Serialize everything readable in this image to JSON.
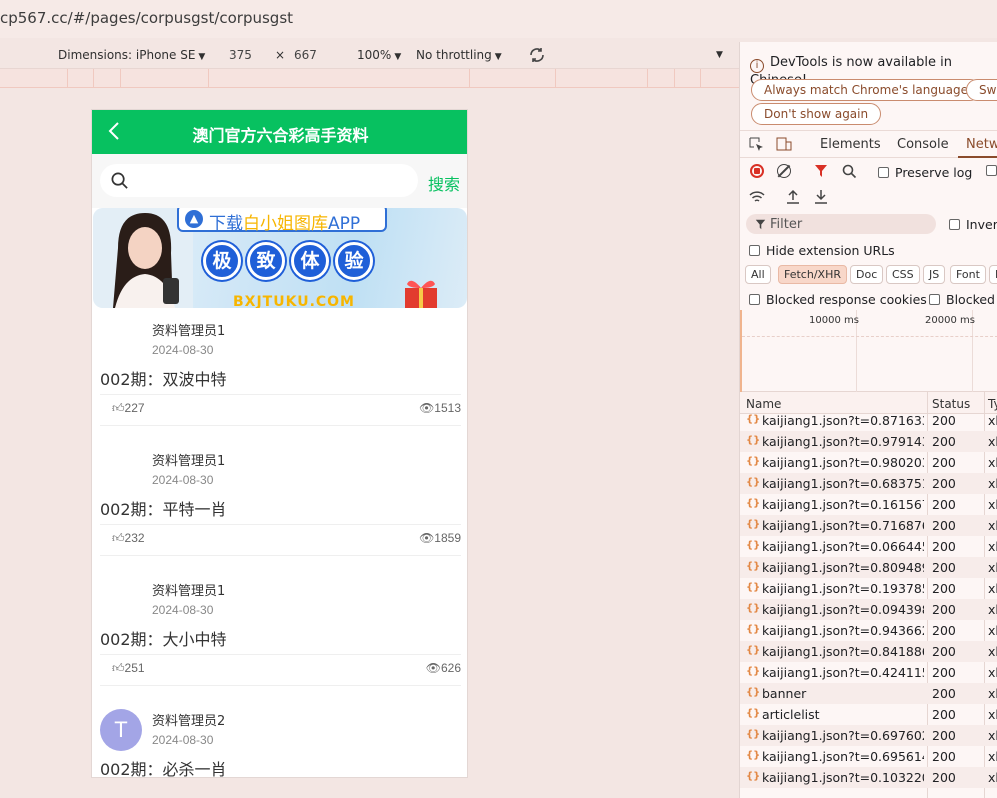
{
  "browser": {
    "url": "cp567.cc/#/pages/corpusgst/corpusgst"
  },
  "device_toolbar": {
    "dimensions_label": "Dimensions: iPhone SE",
    "width": "375",
    "times": "×",
    "height": "667",
    "zoom": "100%",
    "throttling": "No throttling"
  },
  "phone": {
    "title": "澳门官方六合彩高手资料",
    "search_placeholder": "",
    "search_button": "搜索",
    "banner": {
      "pill_prefix": "下载",
      "pill_highlight": "白小姐图库",
      "pill_suffix": "APP",
      "chars": [
        "极",
        "致",
        "体",
        "验"
      ],
      "domain": "BXJTUKU.COM"
    },
    "posts": [
      {
        "author": "资料管理员1",
        "date": "2024-08-30",
        "title": "002期：双波中特",
        "likes": "227",
        "views": "1513",
        "avatar": ""
      },
      {
        "author": "资料管理员1",
        "date": "2024-08-30",
        "title": "002期：平特一肖",
        "likes": "232",
        "views": "1859",
        "avatar": ""
      },
      {
        "author": "资料管理员1",
        "date": "2024-08-30",
        "title": "002期：大小中特",
        "likes": "251",
        "views": "626",
        "avatar": ""
      },
      {
        "author": "资料管理员2",
        "date": "2024-08-30",
        "title": "002期：必杀一肖",
        "likes": "",
        "views": "",
        "avatar": "T"
      }
    ]
  },
  "devtools": {
    "notice": "DevTools is now available in Chinese!",
    "btn_match": "Always match Chrome's language",
    "btn_switch": "Swi",
    "btn_dont_show": "Don't show again",
    "tabs": [
      "Elements",
      "Console",
      "Netw"
    ],
    "preserve_log": "Preserve log",
    "filter_placeholder": "Filter",
    "invert": "Invert",
    "hide_ext": "Hide extension URLs",
    "types": [
      "All",
      "Fetch/XHR",
      "Doc",
      "CSS",
      "JS",
      "Font",
      "I"
    ],
    "blocked_cookies": "Blocked response cookies",
    "blocked_req": "Blocked r",
    "timeline": [
      "10000 ms",
      "20000 ms"
    ],
    "columns": [
      "Name",
      "Status",
      "Ty"
    ],
    "requests": [
      {
        "name": "kaijiang1.json?t=0.871633...",
        "status": "200",
        "type": "xh"
      },
      {
        "name": "kaijiang1.json?t=0.979143...",
        "status": "200",
        "type": "xh"
      },
      {
        "name": "kaijiang1.json?t=0.980203...",
        "status": "200",
        "type": "xh"
      },
      {
        "name": "kaijiang1.json?t=0.683751...",
        "status": "200",
        "type": "xh"
      },
      {
        "name": "kaijiang1.json?t=0.161567...",
        "status": "200",
        "type": "xh"
      },
      {
        "name": "kaijiang1.json?t=0.716876...",
        "status": "200",
        "type": "xh"
      },
      {
        "name": "kaijiang1.json?t=0.066445...",
        "status": "200",
        "type": "xh"
      },
      {
        "name": "kaijiang1.json?t=0.809489...",
        "status": "200",
        "type": "xh"
      },
      {
        "name": "kaijiang1.json?t=0.193785...",
        "status": "200",
        "type": "xh"
      },
      {
        "name": "kaijiang1.json?t=0.094398...",
        "status": "200",
        "type": "xh"
      },
      {
        "name": "kaijiang1.json?t=0.943662...",
        "status": "200",
        "type": "xh"
      },
      {
        "name": "kaijiang1.json?t=0.841886...",
        "status": "200",
        "type": "xh"
      },
      {
        "name": "kaijiang1.json?t=0.424115...",
        "status": "200",
        "type": "xh"
      },
      {
        "name": "banner",
        "status": "200",
        "type": "xh"
      },
      {
        "name": "articlelist",
        "status": "200",
        "type": "xh"
      },
      {
        "name": "kaijiang1.json?t=0.697602...",
        "status": "200",
        "type": "xh"
      },
      {
        "name": "kaijiang1.json?t=0.695614...",
        "status": "200",
        "type": "xh"
      },
      {
        "name": "kaijiang1.json?t=0.103220...",
        "status": "200",
        "type": "xh"
      }
    ]
  }
}
